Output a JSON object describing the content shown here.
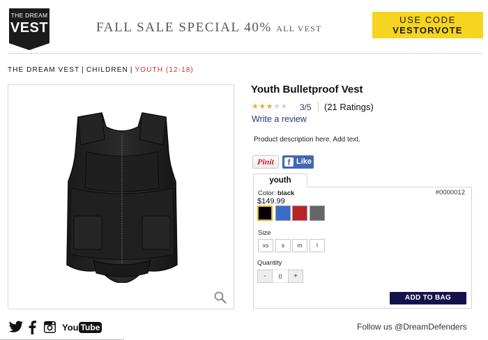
{
  "header": {
    "logo_line1": "THE DREAM",
    "logo_line2": "VEST",
    "promo_main": "FALL SALE SPECIAL 40%",
    "promo_small": "ALL VEST",
    "code_line1": "USE CODE",
    "code_line2": "VESTORVOTE"
  },
  "breadcrumb": {
    "items": [
      "THE DREAM VEST",
      "CHILDREN"
    ],
    "current": "YOUTH (12-18)",
    "separator": "|"
  },
  "product": {
    "title": "Youth Bulletproof Vest",
    "rating_stars": 3,
    "rating_max": 5,
    "rating_text": "3/5",
    "rating_count": "(21 Ratings)",
    "write_review": "Write a review",
    "description": "Product description here. Add text.",
    "pinit_label": "Pinit",
    "like_label": "Like",
    "tab_label": "youth",
    "color_prefix": "Color:",
    "color_value": "black",
    "sku": "#0000012",
    "price": "$149.99",
    "swatches": [
      {
        "name": "black",
        "color": "#000000",
        "selected": true
      },
      {
        "name": "blue",
        "color": "#3a6cc7",
        "selected": false
      },
      {
        "name": "red",
        "color": "#b8232a",
        "selected": false
      },
      {
        "name": "gray",
        "color": "#666666",
        "selected": false
      }
    ],
    "size_label": "Size",
    "sizes": [
      "xs",
      "s",
      "m",
      "l"
    ],
    "quantity_label": "Quantity",
    "quantity_minus": "-",
    "quantity_value": "0",
    "quantity_plus": "+",
    "add_to_bag": "ADD TO BAG"
  },
  "footer": {
    "social_icons": [
      "twitter-icon",
      "facebook-icon",
      "instagram-icon",
      "youtube-icon"
    ],
    "youtube_you": "You",
    "youtube_tube": "Tube",
    "follow_text": "Follow us @DreamDefenders"
  },
  "colors": {
    "promo_yellow": "#f6d41f",
    "breadcrumb_accent": "#d0312d",
    "star_gold": "#f0a830",
    "button_navy": "#15124b",
    "facebook_blue": "#4267b2"
  }
}
